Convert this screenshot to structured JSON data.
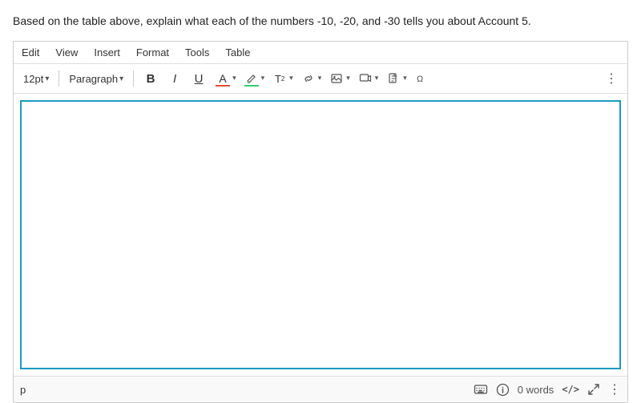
{
  "question": {
    "text": "Based on the table above, explain what each of the numbers -10, -20, and -30 tells you about Account 5."
  },
  "menu": {
    "items": [
      {
        "label": "Edit",
        "id": "edit"
      },
      {
        "label": "View",
        "id": "view"
      },
      {
        "label": "Insert",
        "id": "insert"
      },
      {
        "label": "Format",
        "id": "format"
      },
      {
        "label": "Tools",
        "id": "tools"
      },
      {
        "label": "Table",
        "id": "table"
      }
    ]
  },
  "toolbar": {
    "font_size": "12pt",
    "paragraph": "Paragraph",
    "bold_label": "B",
    "italic_label": "I",
    "underline_label": "U",
    "font_color_label": "A",
    "highlight_label": "✏",
    "superscript_label": "T²",
    "link_label": "🔗",
    "image_label": "🖼",
    "media_label": "▶",
    "document_label": "📄",
    "special_label": "⇌",
    "more_label": "⋮"
  },
  "statusbar": {
    "paragraph_indicator": "p",
    "keyboard_icon": "⌨",
    "info_icon": "ℹ",
    "word_count_label": "0 words",
    "code_label": "</>",
    "expand_label": "↗",
    "more_label": "⋮"
  }
}
